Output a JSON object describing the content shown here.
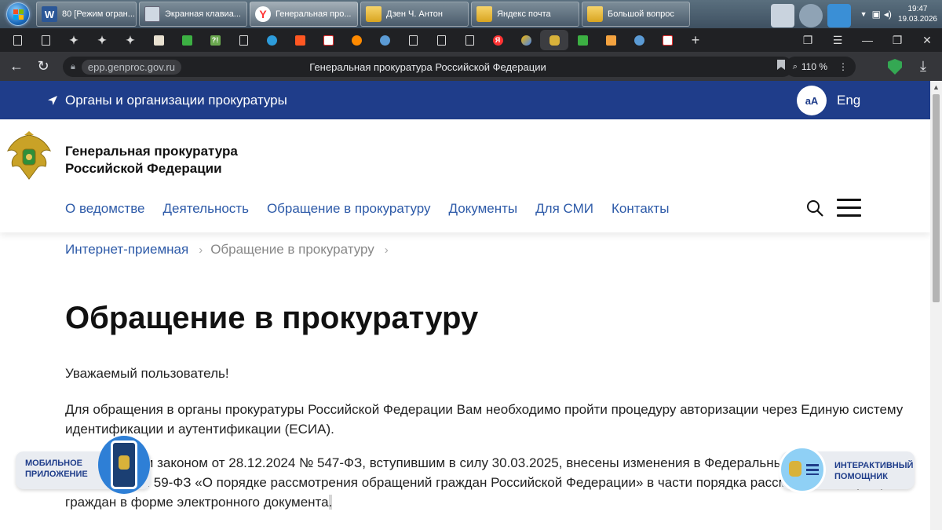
{
  "taskbar": {
    "items": [
      {
        "label": "80 [Режим огран...",
        "icon": "word-icon"
      },
      {
        "label": "Экранная клавиа...",
        "icon": "keyboard-icon"
      },
      {
        "label": "Генеральная про...",
        "icon": "yandex-browser-icon"
      },
      {
        "label": "Дзен Ч. Антон",
        "icon": "folder-icon"
      },
      {
        "label": "Яндекс почта",
        "icon": "folder-icon"
      },
      {
        "label": "Большой вопрос",
        "icon": "folder-icon"
      }
    ],
    "time": "19:47",
    "date": "19.03.2026"
  },
  "browser": {
    "domain": "epp.genproc.gov.ru",
    "title": "Генеральная прокуратура Российской Федерации",
    "zoom": "110 %"
  },
  "topbar": {
    "orgs_link": "Органы и организации прокуратуры",
    "font_size_button": "аА",
    "lang": "Eng"
  },
  "header": {
    "title_line1": "Генеральная прокуратура",
    "title_line2": "Российской Федерации",
    "nav": [
      "О ведомстве",
      "Деятельность",
      "Обращение в прокуратуру",
      "Документы",
      "Для СМИ",
      "Контакты"
    ]
  },
  "breadcrumb": {
    "items": [
      "Интернет-приемная",
      "Обращение в прокуратуру"
    ]
  },
  "content": {
    "heading": "Обращение в прокуратуру",
    "greeting": "Уважаемый пользователь!",
    "p1": "Для обращения в органы прокуратуры Российской Федерации Вам необходимо пройти процедуру авторизации через Единую систему идентификации и аутентификации (ЕСИА).",
    "p2_main": "Федеральным законом от 28.12.2024 № 547-ФЗ, вступившим в силу 30.03.2025, внесены изменения в Федеральный закон от 02.05.2006 № 59-ФЗ «О порядке рассмотрения обращений граждан Российской Федерации» в части порядка рассмотрения обращений граждан в форме электронного документа",
    "p2_tail": "."
  },
  "widgets": {
    "mobile_line1": "МОБИЛЬНОЕ",
    "mobile_line2": "ПРИЛОЖЕНИЕ",
    "assistant_line1": "ИНТЕРАКТИВНЫЙ",
    "assistant_line2": "ПОМОЩНИК"
  },
  "colors": {
    "brand_blue": "#1f3d8a",
    "link_blue": "#2d5aa8"
  }
}
